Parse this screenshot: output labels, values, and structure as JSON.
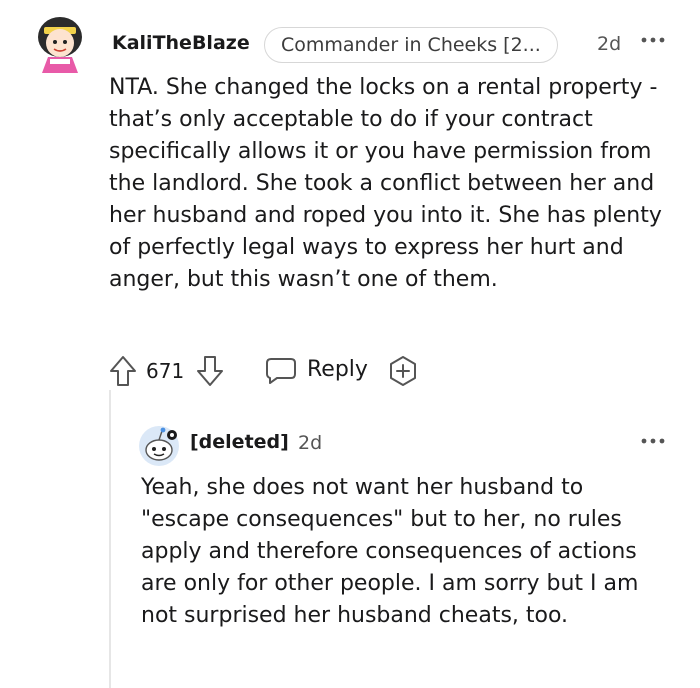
{
  "comment": {
    "username": "KaliTheBlaze",
    "flair": "Commander in Cheeks [2...",
    "age": "2d",
    "body": "NTA. She changed the locks on a rental property - that’s only acceptable to do if your contract specifically allows it or you have permission from the landlord. She took a conflict between her and her husband and roped you into it. She has plenty of perfectly legal ways to express her hurt and anger, but this wasn’t one of them.",
    "votes": "671",
    "reply_label": "Reply"
  },
  "reply": {
    "username": "[deleted]",
    "age": "2d",
    "body": "Yeah, she does not want her husband to \"escape consequences\" but to her, no rules apply and therefore consequences of actions are only for other people. I am sorry but I am not surprised her husband cheats, too."
  },
  "icons": {
    "upvote": "arrow-up-icon",
    "downvote": "arrow-down-icon",
    "reply": "speech-bubble-icon",
    "award": "award-plus-icon",
    "more": "more-dots-icon"
  },
  "colors": {
    "text": "#1a1a1b",
    "meta": "#555555",
    "avatar_pink": "#e85aa8",
    "avatar_blue": "#4a90e2"
  }
}
